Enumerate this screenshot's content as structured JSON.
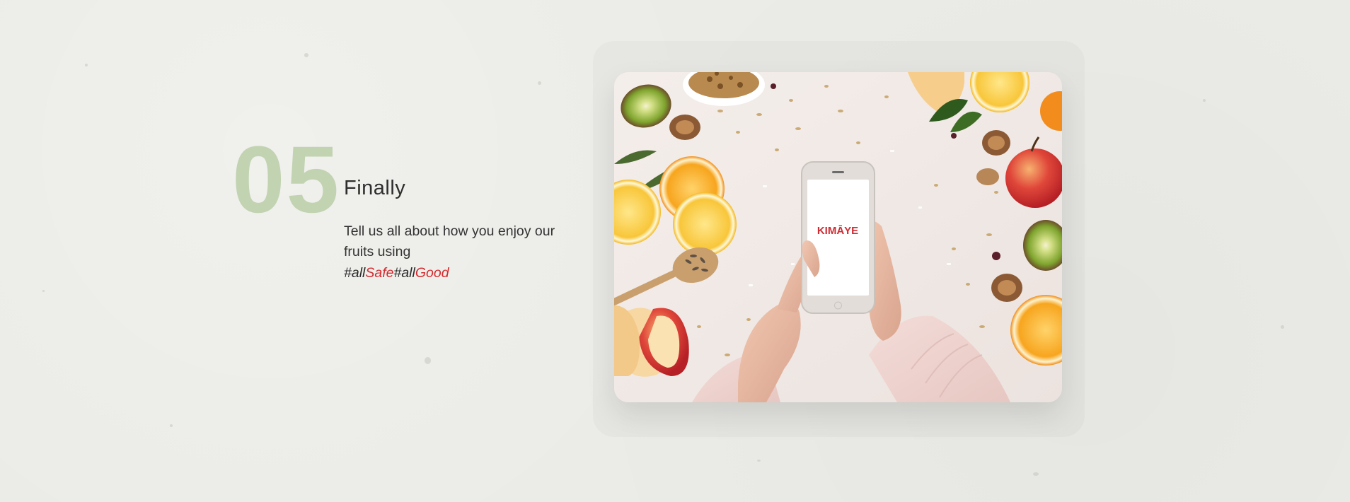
{
  "step": {
    "number": "05",
    "title": "Finally",
    "body": "Tell us all about how you enjoy our fruits using",
    "hashtags": {
      "part1": "#all",
      "part2": "Safe",
      "part3": "#all",
      "part4": "Good"
    }
  },
  "photo": {
    "brand": "KIMĀYE"
  },
  "colors": {
    "background": "#ebebe7",
    "step_number": "#b9cfa7",
    "accent": "#d42a2f",
    "text": "#333333"
  }
}
